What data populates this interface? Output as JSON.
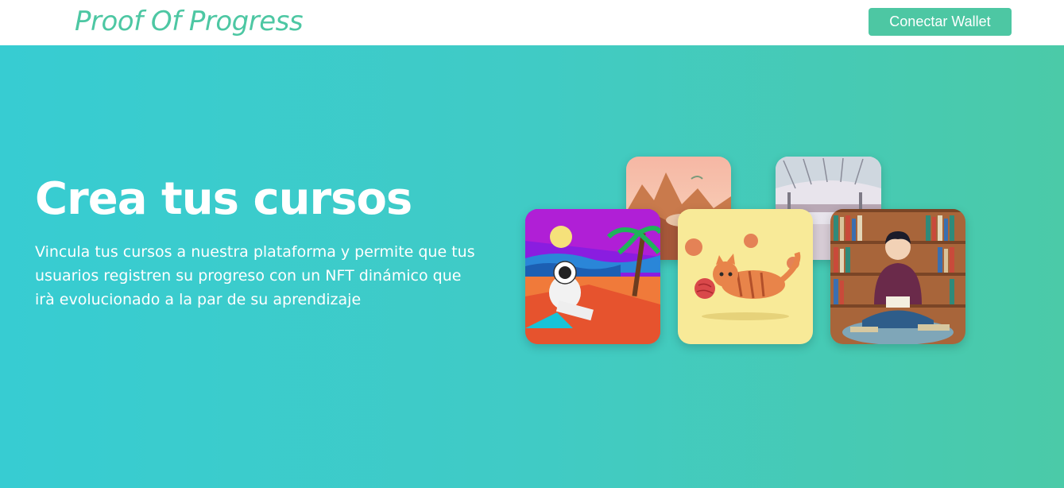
{
  "header": {
    "logo_text": "Proof Of Progress",
    "connect_button_label": "Conectar Wallet"
  },
  "hero": {
    "title": "Crea tus cursos",
    "description": "Vincula tus cursos a nuestra plataforma y permite que tus usuarios registren su progreso con un NFT dinámico que irà evolucionado a la par de su aprendizaje"
  },
  "colors": {
    "brand": "#4dc7a3",
    "hero_gradient_start": "#37ccd2",
    "hero_gradient_end": "#4bcaa8",
    "text_on_hero": "#ffffff"
  },
  "gallery": {
    "images": [
      "desert-landscape-image",
      "mall-interior-image",
      "astronaut-beach-image",
      "cat-yarn-image",
      "reader-library-image"
    ]
  }
}
